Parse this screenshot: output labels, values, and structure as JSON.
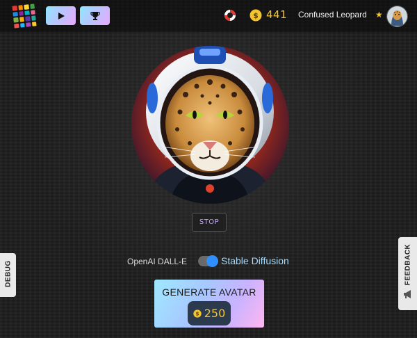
{
  "header": {
    "logo_icon": "tile-grid-logo",
    "logo_colors": [
      "#e53935",
      "#fb8c00",
      "#fdd835",
      "#43a047",
      "#1e88e5",
      "#8e24aa",
      "#00acc1",
      "#f06292",
      "#7cb342",
      "#ffb300",
      "#5e35b1",
      "#26a69a",
      "#ef5350",
      "#29b6f6",
      "#ab47bc",
      "#ffca28"
    ],
    "play_icon": "play-icon",
    "trophy_icon": "trophy-icon",
    "help_icon": "lifebuoy-icon",
    "coin_icon": "coin-icon",
    "coins": "441",
    "username": "Confused Leopard",
    "user_badge": "★"
  },
  "main": {
    "portrait": "leopard-astronaut-portrait",
    "stop_label": "STOP",
    "model_left": "OpenAI DALL-E",
    "model_right": "Stable Diffusion",
    "toggle_value": "Stable Diffusion",
    "generate_label": "GENERATE AVATAR",
    "generate_cost": "250"
  },
  "side": {
    "debug_label": "DEBUG",
    "feedback_label": "FEEDBACK"
  },
  "colors": {
    "accent_gold": "#f4c430",
    "toggle_blue": "#2f8fff",
    "stop_text": "#c7a6ff",
    "model_right": "#a8dcff"
  }
}
